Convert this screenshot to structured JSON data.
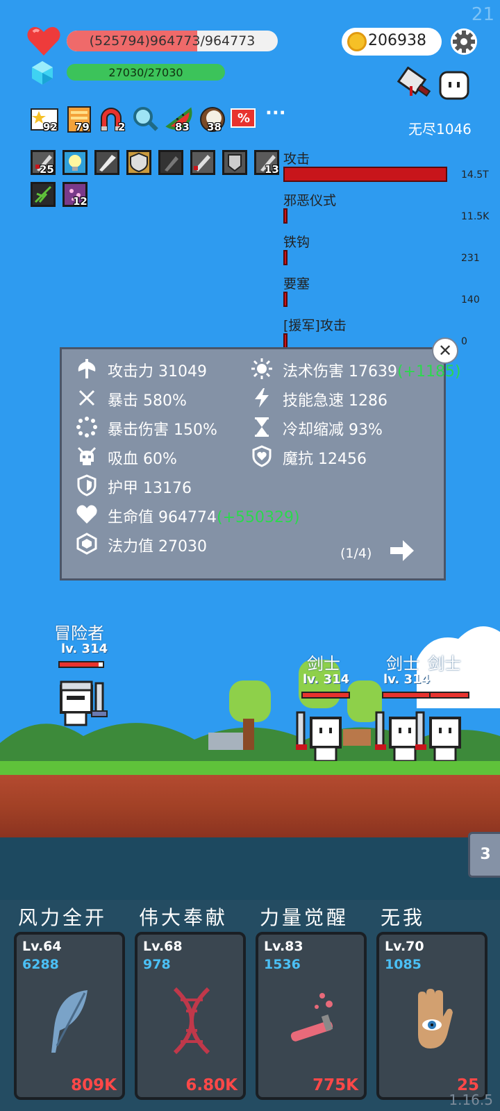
{
  "fps": "21",
  "player": {
    "hp_text": "(525794)964773/964773",
    "hp_ratio": 0.62,
    "mp_text": "27030/27030",
    "coins": "206938"
  },
  "mode": {
    "label": "无尽1046"
  },
  "buffs": [
    {
      "icon": "star-card-icon",
      "count": "92"
    },
    {
      "icon": "book-icon",
      "count": "79"
    },
    {
      "icon": "magnet-icon",
      "count": "2"
    },
    {
      "icon": "magnifier-icon",
      "count": ""
    },
    {
      "icon": "watermelon-icon",
      "count": "83"
    },
    {
      "icon": "coconut-icon",
      "count": "38"
    },
    {
      "icon": "percent-icon",
      "count": "%"
    },
    {
      "icon": "more-icon",
      "count": "···"
    }
  ],
  "equipped": [
    {
      "icon": "blade-icon",
      "count": "25"
    },
    {
      "icon": "lightbulb-icon",
      "count": ""
    },
    {
      "icon": "blade-icon",
      "count": ""
    },
    {
      "icon": "shield-icon",
      "count": ""
    },
    {
      "icon": "dagger-icon",
      "count": ""
    },
    {
      "icon": "blade-icon",
      "count": ""
    },
    {
      "icon": "armor-icon",
      "count": ""
    },
    {
      "icon": "blade-icon",
      "count": "13"
    },
    {
      "icon": "vine-icon",
      "count": ""
    },
    {
      "icon": "crystal-icon",
      "count": "12"
    }
  ],
  "damage": [
    {
      "label": "攻击",
      "value": "14.5T",
      "ratio": 1.0
    },
    {
      "label": "邪恶仪式",
      "value": "11.5K",
      "ratio": 0.02
    },
    {
      "label": "铁钩",
      "value": "231",
      "ratio": 0.01
    },
    {
      "label": "要塞",
      "value": "140",
      "ratio": 0.01
    },
    {
      "label": "[援军]攻击",
      "value": "0",
      "ratio": 0.0
    }
  ],
  "stats": {
    "atk_label": "攻击力",
    "atk": "31049",
    "crit_label": "暴击",
    "crit": "580%",
    "critdmg_label": "暴击伤害",
    "critdmg": "150%",
    "lifesteal_label": "吸血",
    "lifesteal": "60%",
    "armor_label": "护甲",
    "armor": "13176",
    "hp_label": "生命值",
    "hp": "964774",
    "hp_bonus": "(+550329)",
    "mana_label": "法力值",
    "mana": "27030",
    "magic_label": "法术伤害",
    "magic": "17639",
    "magic_bonus": "(+1185)",
    "haste_label": "技能急速",
    "haste": "1286",
    "cdr_label": "冷却缩减",
    "cdr": "93%",
    "mres_label": "魔抗",
    "mres": "12456",
    "page": "(1/4)",
    "close": "✕"
  },
  "hero": {
    "name": "冒险者",
    "level": "lv. 314",
    "hp_ratio": 0.9
  },
  "enemies": [
    {
      "name": "剑士",
      "level": "lv. 314"
    },
    {
      "name": "剑士",
      "level": "lv. 314"
    },
    {
      "name": "剑士",
      "level": "lv. 314"
    }
  ],
  "side_tab": "3",
  "skills": [
    {
      "name": "风力全开",
      "level": "Lv.64",
      "value": "6288",
      "cost": "809K",
      "icon": "feather-icon"
    },
    {
      "name": "伟大奉献",
      "level": "Lv.68",
      "value": "978",
      "cost": "6.80K",
      "icon": "dna-icon"
    },
    {
      "name": "力量觉醒",
      "level": "Lv.83",
      "value": "1536",
      "cost": "775K",
      "icon": "potion-vial-icon"
    },
    {
      "name": "无我",
      "level": "Lv.70",
      "value": "1085",
      "cost": "25",
      "icon": "eye-hand-icon"
    }
  ],
  "version": "1.16.5",
  "colors": {
    "sky": "#2e9bf0",
    "hp": "#ef6a6a",
    "mp": "#3cc35a",
    "damage_bar": "#c8151b",
    "bonus": "#2cd84e",
    "cost": "#ff4848",
    "skill_value": "#4bc0f5"
  }
}
